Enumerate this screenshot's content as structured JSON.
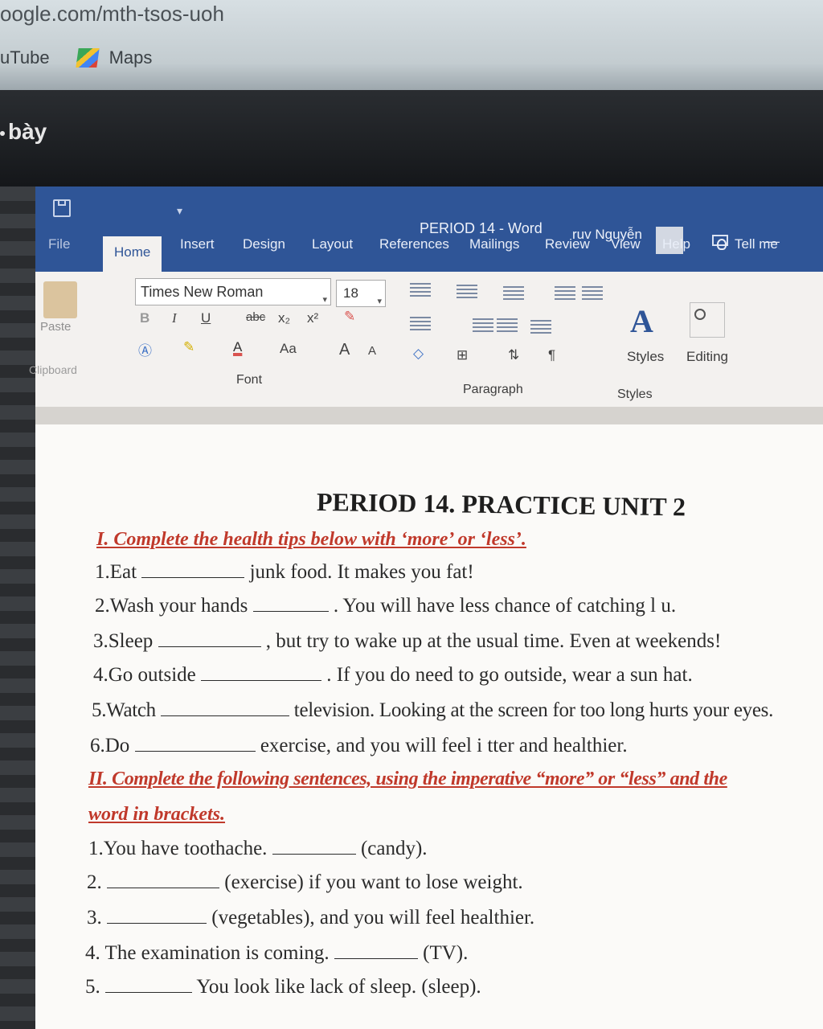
{
  "browser": {
    "url": "oogle.com/mth-tsos-uoh",
    "bookmarks": [
      "uTube",
      "Maps"
    ],
    "tab_text": "bày"
  },
  "word": {
    "title": "PERIOD 14  -  Word",
    "user": "ruv Nguyễn",
    "tabs": [
      "File",
      "Home",
      "Insert",
      "Design",
      "Layout",
      "References",
      "Mailings",
      "Review",
      "View",
      "Help",
      "Tell me"
    ],
    "font_name": "Times New Roman",
    "font_size": "18",
    "paste_label": "Paste",
    "clipboard_label": "Clipboard",
    "font_group_label": "Font",
    "paragraph_group_label": "Paragraph",
    "styles_label": "Styles",
    "styles_group_label": "Styles",
    "editing_label": "Editing",
    "format_buttons": {
      "bold": "B",
      "italic": "I",
      "underline": "U",
      "strike": "abc",
      "subscript": "x₂",
      "superscript": "x²",
      "case": "Aa",
      "grow": "A",
      "shrink": "A"
    }
  },
  "document": {
    "heading": "PERIOD 14. PRACTICE UNIT 2",
    "section1": "I. Complete the health tips below with ‘more’ or ‘less’.",
    "section1_items": [
      {
        "pre": "1.Eat",
        "post": "junk food. It makes you fat!"
      },
      {
        "pre": "2.Wash your hands",
        "post": ". You will have less chance of catching l u."
      },
      {
        "pre": "3.Sleep",
        "post": ", but try to wake up at the usual time. Even at weekends!"
      },
      {
        "pre": "4.Go outside",
        "post": ". If you do need to go outside, wear a sun hat."
      },
      {
        "pre": "5.Watch",
        "post": "television. Looking at the screen for too long hurts your eyes."
      },
      {
        "pre": "6.Do",
        "post": "exercise, and you will feel i tter and healthier."
      }
    ],
    "section2_line1": "II. Complete the following sentences, using the imperative “more” or “less” and the",
    "section2_line2": "word in brackets.",
    "section2_items": [
      {
        "pre": "1.You have toothache.",
        "post": "(candy)."
      },
      {
        "pre": "2.",
        "post": "(exercise) if you want to lose weight."
      },
      {
        "pre": "3.",
        "post": "(vegetables), and you will feel healthier."
      },
      {
        "pre": "4. The examination is coming.",
        "post": "(TV)."
      },
      {
        "pre": "5.",
        "post": "You look like lack of sleep.  (sleep)."
      }
    ]
  }
}
